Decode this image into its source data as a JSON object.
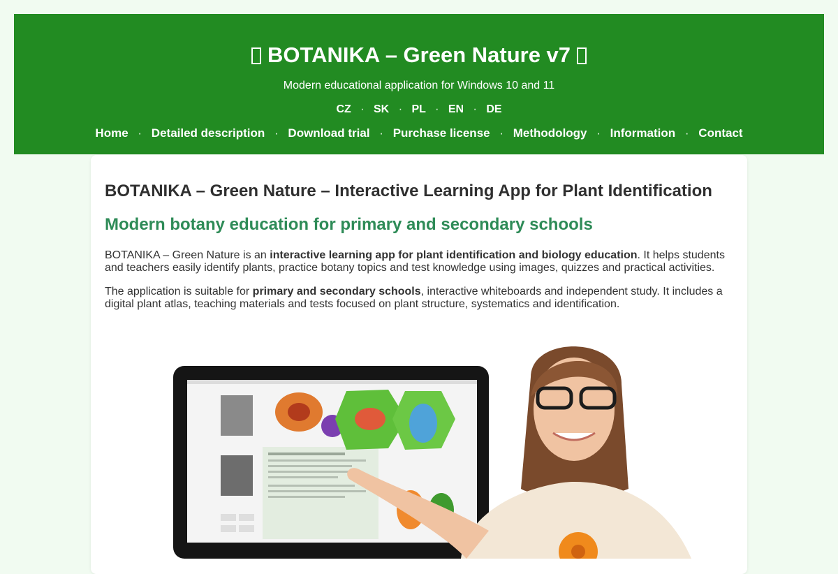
{
  "header": {
    "title_left_glyph": "",
    "title": "BOTANIKA – Green Nature v7",
    "title_right_glyph": "",
    "subtitle": "Modern educational application for Windows 10 and 11",
    "languages": [
      "CZ",
      "SK",
      "PL",
      "EN",
      "DE"
    ],
    "separator": "·",
    "nav": [
      "Home",
      "Detailed description",
      "Download trial",
      "Purchase license",
      "Methodology",
      "Information",
      "Contact"
    ]
  },
  "main": {
    "heading": "BOTANIKA – Green Nature – Interactive Learning App for Plant Identification",
    "subheading": "Modern botany education for primary and secondary schools",
    "p1": {
      "before": "BOTANIKA – Green Nature is an ",
      "bold": "interactive learning app for plant identification and biology education",
      "after": ". It helps students and teachers easily identify plants, practice botany topics and test knowledge using images, quizzes and practical activities."
    },
    "p2": {
      "before": "The application is suitable for ",
      "bold": "primary and secondary schools",
      "after": ", interactive whiteboards and independent study. It includes a digital plant atlas, teaching materials and tests focused on plant structure, systematics and identification."
    }
  },
  "colors": {
    "page_bg": "#f1fbf1",
    "header_bg": "#228b22",
    "subheading": "#2e8b57",
    "text": "#333333"
  }
}
